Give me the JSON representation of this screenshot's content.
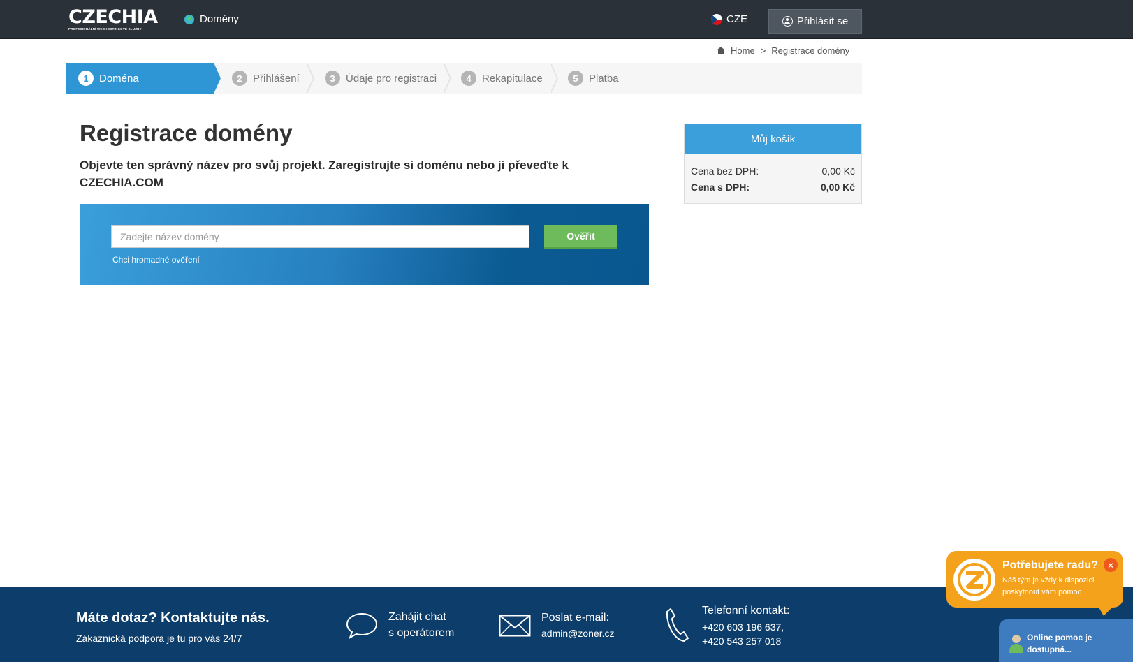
{
  "header": {
    "logo_text": "CZECHIA",
    "logo_tagline": "PROFESIONÁLNÍ WEBHOSTINGOVÉ SLUŽBY",
    "nav_domains": "Domény",
    "language": "CZE",
    "login_label": "Přihlásit se"
  },
  "breadcrumb": {
    "home": "Home",
    "separator": ">",
    "current": "Registrace domény"
  },
  "steps": [
    {
      "num": "1",
      "label": "Doména"
    },
    {
      "num": "2",
      "label": "Přihlášení"
    },
    {
      "num": "3",
      "label": "Údaje pro registraci"
    },
    {
      "num": "4",
      "label": "Rekapitulace"
    },
    {
      "num": "5",
      "label": "Platba"
    }
  ],
  "main": {
    "title": "Registrace domény",
    "subtitle": "Objevte ten správný název pro svůj projekt. Zaregistrujte si doménu nebo ji převeďte k CZECHIA.COM",
    "search_placeholder": "Zadejte název domény",
    "search_value": "",
    "verify_label": "Ověřit",
    "bulk_link": "Chci hromadné ověření"
  },
  "cart": {
    "title": "Můj košík",
    "price_without_vat_label": "Cena bez DPH:",
    "price_without_vat": "0,00 Kč",
    "price_with_vat_label": "Cena s DPH:",
    "price_with_vat": "0,00 Kč"
  },
  "footer": {
    "title": "Máte dotaz? Kontaktujte nás.",
    "subtitle": "Zákaznická podpora je tu pro vás 24/7",
    "chat_line1": "Zahájit chat",
    "chat_line2": "s operátorem",
    "email_label": "Poslat e-mail:",
    "email_address": "admin@zoner.cz",
    "phone_label": "Telefonní kontakt:",
    "phone1": "+420 603 196 637,",
    "phone2": "+420 543 257 018"
  },
  "help_widget": {
    "title": "Potřebujete radu?",
    "text": "Náš tým je vždy k dispozici poskytnout vám pomoc",
    "close": "×",
    "online_text": "Online pomoc je dostupná..."
  },
  "colors": {
    "header_bg": "#2b3138",
    "accent_blue": "#2f96d6",
    "verify_green": "#6dbb5b",
    "footer_bg": "#0c3d6b",
    "help_orange": "#f4a11c"
  },
  "icons": {
    "nav": "globe-icon",
    "language": "czech-flag-icon",
    "login": "user-circle-icon",
    "breadcrumb": "home-icon",
    "chat": "chat-bubble-icon",
    "email": "envelope-icon",
    "phone": "phone-icon"
  }
}
